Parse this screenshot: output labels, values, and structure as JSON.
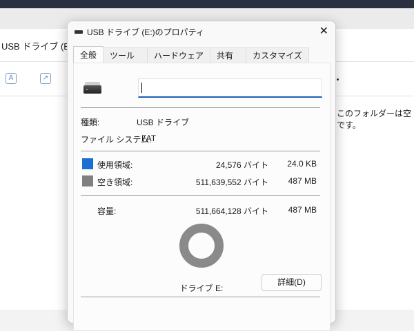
{
  "explorer": {
    "address": "USB ドライブ (E:)",
    "empty_message": "このフォルダーは空です。"
  },
  "dialog": {
    "title": "USB ドライブ (E:)のプロパティ",
    "tabs": [
      "全般",
      "ツール",
      "ハードウェア",
      "共有",
      "カスタマイズ"
    ],
    "name_value": "",
    "type_label": "種類:",
    "type_value": "USB ドライブ",
    "fs_label": "ファイル システム:",
    "fs_value": "FAT",
    "used": {
      "label": "使用領域:",
      "bytes": "24,576 バイト",
      "size": "24.0 KB",
      "color": "#1a6fd0"
    },
    "free": {
      "label": "空き領域:",
      "bytes": "511,639,552 バイト",
      "size": "487 MB",
      "color": "#808080"
    },
    "capacity": {
      "label": "容量:",
      "bytes": "511,664,128 バイト",
      "size": "487 MB"
    },
    "drive_label": "ドライブ E:",
    "details_button": "詳細(D)"
  }
}
